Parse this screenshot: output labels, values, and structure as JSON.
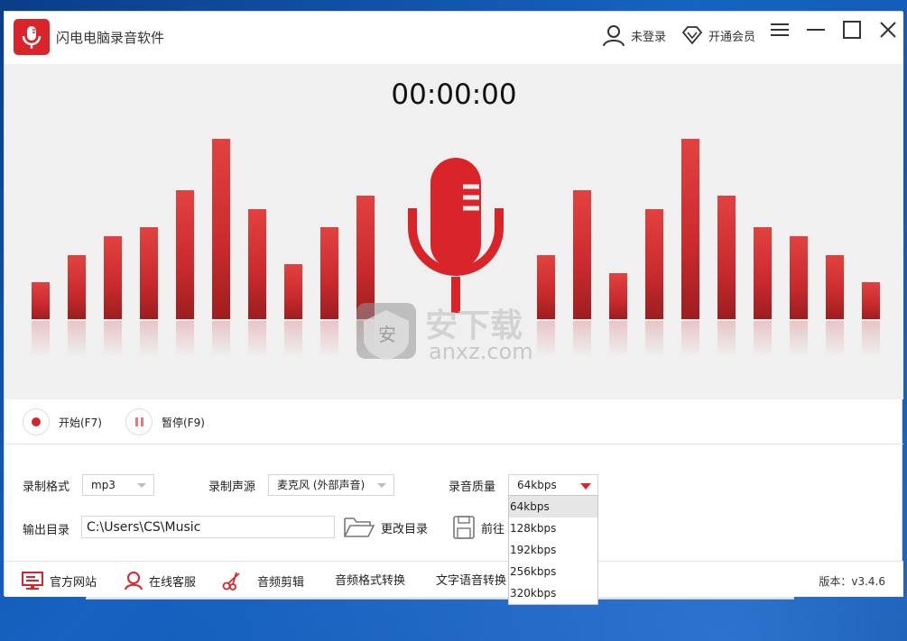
{
  "app": {
    "title": "闪电电脑录音软件",
    "accent_color": "#d9252a",
    "logo_icon": "microphone-icon"
  },
  "header": {
    "login_label": "未登录",
    "login_icon": "user-icon",
    "vip_label": "开通会员",
    "vip_icon": "diamond-icon",
    "menu_icon": "hamburger-menu-icon",
    "minimize_icon": "minimize-icon",
    "maximize_icon": "maximize-icon",
    "close_icon": "close-icon"
  },
  "visualizer": {
    "timer": "00:00:00",
    "left_bar_levels": [
      0.2,
      0.35,
      0.45,
      0.5,
      0.7,
      0.98,
      0.6,
      0.3,
      0.5,
      0.67
    ],
    "right_bar_levels": [
      0.35,
      0.7,
      0.25,
      0.6,
      0.98,
      0.67,
      0.5,
      0.45,
      0.35,
      0.2
    ],
    "watermark_text": "安下载",
    "watermark_domain": "anxz.com"
  },
  "controls": {
    "start_label": "开始(F7)",
    "pause_label": "暂停(F9)"
  },
  "settings": {
    "format_label": "录制格式",
    "format_value": "mp3",
    "source_label": "录制声源",
    "source_value": "麦克风 (外部声音)",
    "quality_label": "录音质量",
    "quality_value": "64kbps",
    "quality_options": [
      "64kbps",
      "128kbps",
      "192kbps",
      "256kbps",
      "320kbps"
    ],
    "output_label": "输出目录",
    "output_path": "C:\\Users\\CS\\Music",
    "change_dir_label": "更改目录",
    "goto_label": "前往"
  },
  "footer": {
    "website_label": "官方网站",
    "support_label": "在线客服",
    "audio_edit_label": "音频剪辑",
    "format_convert_label": "音频格式转换",
    "tts_label": "文字语音转换",
    "version_label": "版本：v3.4.6"
  }
}
